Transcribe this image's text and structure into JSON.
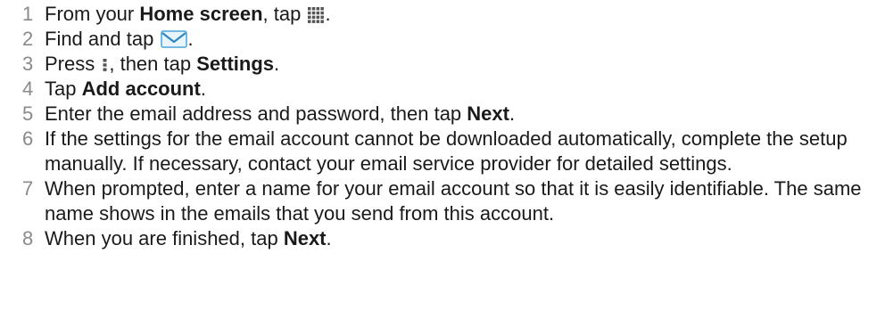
{
  "steps": [
    {
      "n": "1",
      "t1": "From your ",
      "b1": "Home screen",
      "t2": ", tap ",
      "icon": "apps-grid-icon",
      "t3": "."
    },
    {
      "n": "2",
      "t1": "Find and tap ",
      "icon": "email-envelope-icon",
      "t2": "."
    },
    {
      "n": "3",
      "t1": "Press ",
      "icon": "menu-dots-icon",
      "t2": ", then tap ",
      "b1": "Settings",
      "t3": "."
    },
    {
      "n": "4",
      "t1": "Tap ",
      "b1": "Add account",
      "t2": "."
    },
    {
      "n": "5",
      "t1": "Enter the email address and password, then tap ",
      "b1": "Next",
      "t2": "."
    },
    {
      "n": "6",
      "t1": "If the settings for the email account cannot be downloaded automatically, complete the setup manually. If necessary, contact your email service provider for detailed settings."
    },
    {
      "n": "7",
      "t1": "When prompted, enter a name for your email account so that it is easily identifiable. The same name shows in the emails that you send from this account."
    },
    {
      "n": "8",
      "t1": "When you are finished, tap ",
      "b1": "Next",
      "t2": "."
    }
  ],
  "colors": {
    "step_number": "#8a8a8a",
    "body_text": "#1a1a1a",
    "envelope_blue": "#4aa3d9"
  }
}
